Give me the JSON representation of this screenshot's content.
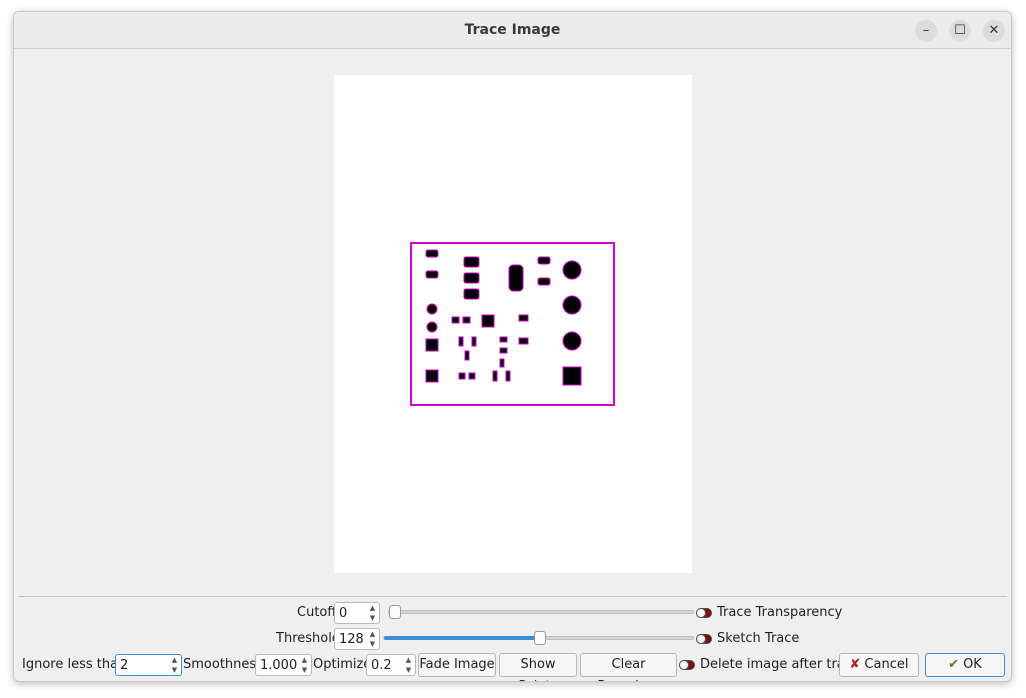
{
  "window": {
    "title": "Trace Image",
    "controls": {
      "minimize": "–",
      "maximize": "☐",
      "close": "✕"
    }
  },
  "row1": {
    "cutoff_label": "Cutoff",
    "cutoff_value": "0",
    "cutoff_slider_level": 0,
    "trace_transparency_label": "Trace Transparency"
  },
  "row2": {
    "threshold_label": "Threshold",
    "threshold_value": "128",
    "threshold_slider_level": 0.5,
    "sketch_trace_label": "Sketch Trace"
  },
  "row3": {
    "ignore_label": "Ignore less than",
    "ignore_value": "2",
    "smoothness_label": "Smoothness",
    "smoothness_value": "1.000",
    "optimize_label": "Optimize",
    "optimize_value": "0.2",
    "fade_image": "Fade Image",
    "show_points": "Show Points",
    "clear_boundary": "Clear Boundary",
    "delete_after_label": "Delete image after trace",
    "cancel": "Cancel",
    "ok": "OK"
  },
  "colors": {
    "trace": "#d600d6",
    "accent": "#3b8ed8",
    "toggle_off": "#7a1010"
  },
  "icons": {
    "cancel": "x-mark-icon",
    "ok": "checkmark-icon"
  }
}
